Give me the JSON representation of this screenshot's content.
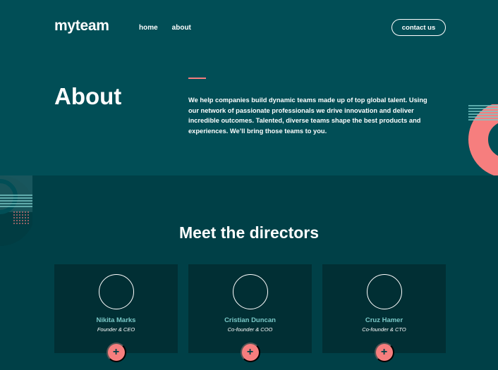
{
  "header": {
    "logo": "myteam",
    "nav": [
      {
        "label": "home"
      },
      {
        "label": "about"
      }
    ],
    "contact_label": "contact us"
  },
  "about": {
    "title": "About",
    "text": "We help companies build dynamic teams made up of top global talent. Using our network of passionate professionals we drive innovation and deliver incredible outcomes. Talented, diverse teams shape the best products and experiences. We’ll bring those teams to you."
  },
  "directors": {
    "title": "Meet the directors",
    "people": [
      {
        "name": "Nikita Marks",
        "role": "Founder & CEO",
        "button": "+"
      },
      {
        "name": "Cristian Duncan",
        "role": "Co-founder & COO",
        "button": "+"
      },
      {
        "name": "Cruz Hamer",
        "role": "Co-founder & CTO",
        "button": "+"
      }
    ]
  },
  "colors": {
    "bg_top": "#014e56",
    "bg_bottom": "#004047",
    "card": "#012f34",
    "accent": "#f67e7e",
    "name": "#79c8c7"
  }
}
